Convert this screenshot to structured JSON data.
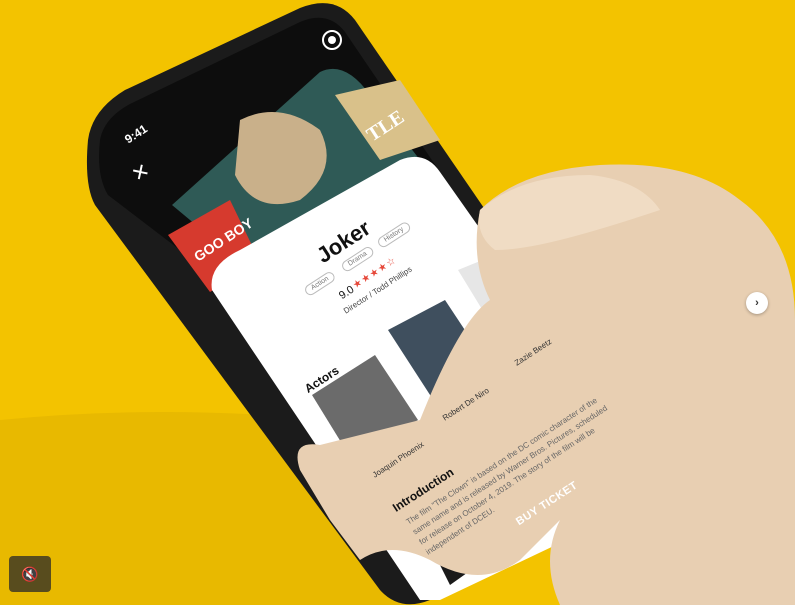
{
  "status": {
    "time": "9:41"
  },
  "movie": {
    "title": "Joker",
    "tags": [
      "Action",
      "Drama",
      "History"
    ],
    "rating": "9.0",
    "stars": "★★★★☆",
    "director": "Director / Todd Phillips"
  },
  "actors_heading": "Actors",
  "actors": [
    {
      "name": "Joaquin Phoenix"
    },
    {
      "name": "Robert De Niro"
    },
    {
      "name": "Zazie Beetz"
    }
  ],
  "intro_heading": "Introduction",
  "intro_text": "The film \"The Clown\" is based on the DC comic character of the same name and is released by Warner Bros. Pictures, scheduled for release on October 4, 2019. The story of the film will be independent of DCEU.",
  "buy_label": "BUY TICKET",
  "poster_text": {
    "left": "GOO BOY",
    "right": "TLE"
  },
  "icons": {
    "close": "close-icon",
    "camera": "camera-icon",
    "mute": "muted-speaker-icon",
    "next": "chevron-right-icon"
  }
}
